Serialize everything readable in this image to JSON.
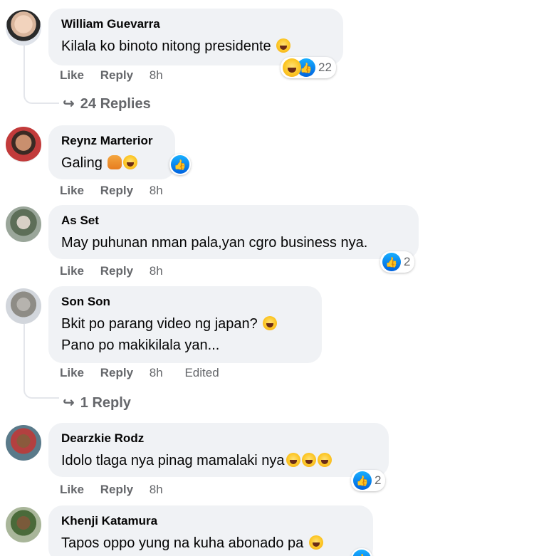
{
  "comments": [
    {
      "author": "William Guevarra",
      "text": "Kilala ko binoto nitong presidente",
      "reactions_count": "22",
      "like": "Like",
      "reply": "Reply",
      "time": "8h",
      "replies_label": "24 Replies"
    },
    {
      "author": "Reynz Marterior",
      "text": "Galing",
      "like": "Like",
      "reply": "Reply",
      "time": "8h"
    },
    {
      "author": "As Set",
      "text": "May puhunan nman pala,yan cgro business nya.",
      "reactions_count": "2",
      "like": "Like",
      "reply": "Reply",
      "time": "8h"
    },
    {
      "author": "Son Son",
      "text_line1": "Bkit po parang video ng japan?",
      "text_line2": "Pano po makikilala yan...",
      "like": "Like",
      "reply": "Reply",
      "time": "8h",
      "edited": "Edited",
      "replies_label": "1 Reply"
    },
    {
      "author": "Dearzkie Rodz",
      "text": "Idolo tlaga nya pinag mamalaki nya",
      "reactions_count": "2",
      "like": "Like",
      "reply": "Reply",
      "time": "8h"
    },
    {
      "author": "Khenji Katamura",
      "text": "Tapos oppo yung na kuha abonado pa"
    }
  ],
  "colors": {
    "bubble": "#f0f2f5",
    "secondary_text": "#65676b",
    "like_blue": "#0866ff"
  }
}
